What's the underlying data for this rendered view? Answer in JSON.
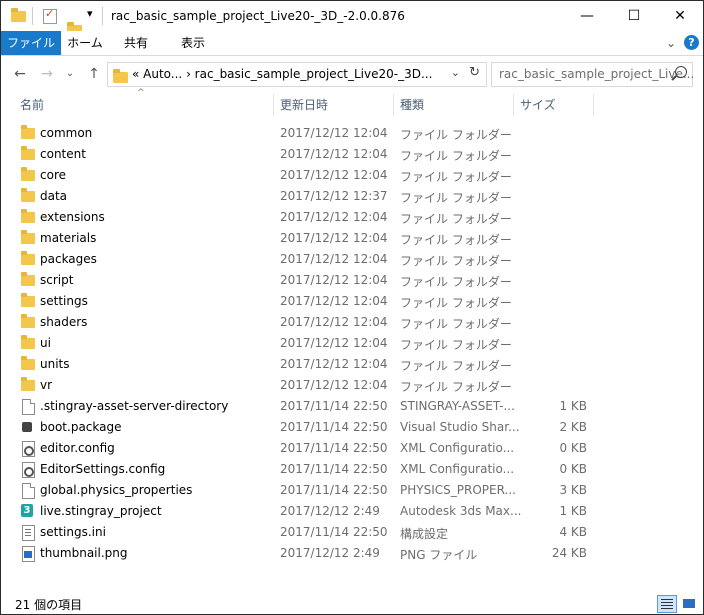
{
  "window": {
    "title": "rac_basic_sample_project_Live20-_3D_-2.0.0.876",
    "qa_dropdown": "▾",
    "minimize": "—",
    "maximize": "☐",
    "close": "✕"
  },
  "ribbon": {
    "tabs": [
      "ファイル",
      "ホーム",
      "共有",
      "表示"
    ],
    "collapse": "⌄",
    "help": "?"
  },
  "nav": {
    "back": "←",
    "forward": "→",
    "history": "⌄",
    "up": "↑",
    "address": "«  Auto...  ›  rac_basic_sample_project_Live20-_3D...",
    "address_dropdown": "⌄",
    "refresh": "↻",
    "search_placeholder": "rac_basic_sample_project_Live..."
  },
  "columns": {
    "name": "名前",
    "date": "更新日時",
    "type": "種類",
    "size": "サイズ",
    "sort_indicator": "^"
  },
  "files": [
    {
      "name": "common",
      "date": "2017/12/12 12:04",
      "type": "ファイル フォルダー",
      "size": "",
      "icon": "folder"
    },
    {
      "name": "content",
      "date": "2017/12/12 12:04",
      "type": "ファイル フォルダー",
      "size": "",
      "icon": "folder"
    },
    {
      "name": "core",
      "date": "2017/12/12 12:04",
      "type": "ファイル フォルダー",
      "size": "",
      "icon": "folder"
    },
    {
      "name": "data",
      "date": "2017/12/12 12:37",
      "type": "ファイル フォルダー",
      "size": "",
      "icon": "folder"
    },
    {
      "name": "extensions",
      "date": "2017/12/12 12:04",
      "type": "ファイル フォルダー",
      "size": "",
      "icon": "folder"
    },
    {
      "name": "materials",
      "date": "2017/12/12 12:04",
      "type": "ファイル フォルダー",
      "size": "",
      "icon": "folder"
    },
    {
      "name": "packages",
      "date": "2017/12/12 12:04",
      "type": "ファイル フォルダー",
      "size": "",
      "icon": "folder"
    },
    {
      "name": "script",
      "date": "2017/12/12 12:04",
      "type": "ファイル フォルダー",
      "size": "",
      "icon": "folder"
    },
    {
      "name": "settings",
      "date": "2017/12/12 12:04",
      "type": "ファイル フォルダー",
      "size": "",
      "icon": "folder"
    },
    {
      "name": "shaders",
      "date": "2017/12/12 12:04",
      "type": "ファイル フォルダー",
      "size": "",
      "icon": "folder"
    },
    {
      "name": "ui",
      "date": "2017/12/12 12:04",
      "type": "ファイル フォルダー",
      "size": "",
      "icon": "folder"
    },
    {
      "name": "units",
      "date": "2017/12/12 12:04",
      "type": "ファイル フォルダー",
      "size": "",
      "icon": "folder"
    },
    {
      "name": "vr",
      "date": "2017/12/12 12:04",
      "type": "ファイル フォルダー",
      "size": "",
      "icon": "folder"
    },
    {
      "name": ".stingray-asset-server-directory",
      "date": "2017/11/14 22:50",
      "type": "STINGRAY-ASSET-...",
      "size": "1 KB",
      "icon": "file"
    },
    {
      "name": "boot.package",
      "date": "2017/11/14 22:50",
      "type": "Visual Studio Shar...",
      "size": "2 KB",
      "icon": "package"
    },
    {
      "name": "editor.config",
      "date": "2017/11/14 22:50",
      "type": "XML Configuratio...",
      "size": "0 KB",
      "icon": "config"
    },
    {
      "name": "EditorSettings.config",
      "date": "2017/11/14 22:50",
      "type": "XML Configuratio...",
      "size": "0 KB",
      "icon": "config"
    },
    {
      "name": "global.physics_properties",
      "date": "2017/11/14 22:50",
      "type": "PHYSICS_PROPER...",
      "size": "3 KB",
      "icon": "file"
    },
    {
      "name": "live.stingray_project",
      "date": "2017/12/12 2:49",
      "type": "Autodesk 3ds Max...",
      "size": "1 KB",
      "icon": "3ds"
    },
    {
      "name": "settings.ini",
      "date": "2017/11/14 22:50",
      "type": "構成設定",
      "size": "4 KB",
      "icon": "ini"
    },
    {
      "name": "thumbnail.png",
      "date": "2017/12/12 2:49",
      "type": "PNG ファイル",
      "size": "24 KB",
      "icon": "png"
    }
  ],
  "status": {
    "count": "21 個の項目"
  },
  "colors": {
    "accent": "#1979ca",
    "folder": "#f3c74b",
    "header_text": "#4c607a",
    "secondary_text": "#6d6d6d"
  }
}
